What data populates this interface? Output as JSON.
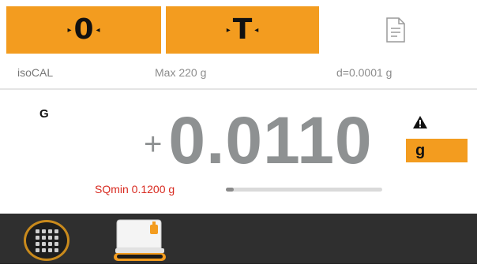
{
  "colors": {
    "accent": "#f39c1f",
    "warning_text": "#d82a20",
    "bottom_bar": "#2f2f2f"
  },
  "toolbar": {
    "zero_label": "0",
    "tare_label": "T",
    "doc_icon": "document-icon"
  },
  "info": {
    "calibration": "isoCAL",
    "max_capacity": "Max 220 g",
    "readability": "d=0.0001 g"
  },
  "reading": {
    "mode": "G",
    "sign": "+",
    "value": "0.0110",
    "unit": "g",
    "warning_icon": "warning-icon"
  },
  "sqmin": {
    "label": "SQmin 0.1200 g",
    "progress_fraction": 0.05
  },
  "bottom": {
    "menu_icon": "app-grid-icon",
    "scale_icon": "scale-icon"
  }
}
